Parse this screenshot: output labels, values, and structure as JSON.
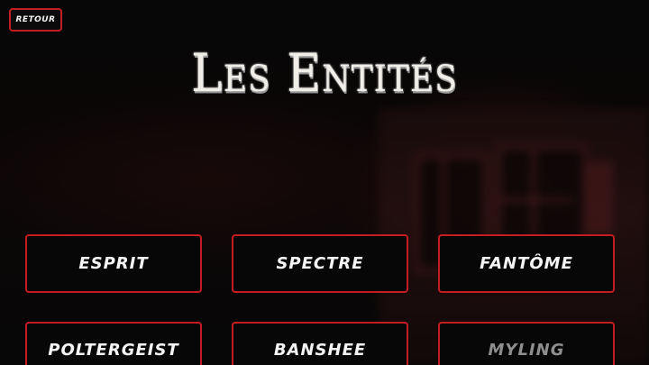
{
  "back_button": {
    "label": "RETOUR"
  },
  "title": "Les Entités",
  "entities": [
    {
      "label": "ESPRIT"
    },
    {
      "label": "SPECTRE"
    },
    {
      "label": "FANTÔME"
    },
    {
      "label": "POLTERGEIST"
    },
    {
      "label": "BANSHEE"
    },
    {
      "label": "MYLING",
      "state": "dimmed"
    }
  ],
  "colors": {
    "accent_border": "#c31d22",
    "text": "#f4f4f4",
    "dimmed_text": "#8e8e8e",
    "background": "#050505"
  }
}
